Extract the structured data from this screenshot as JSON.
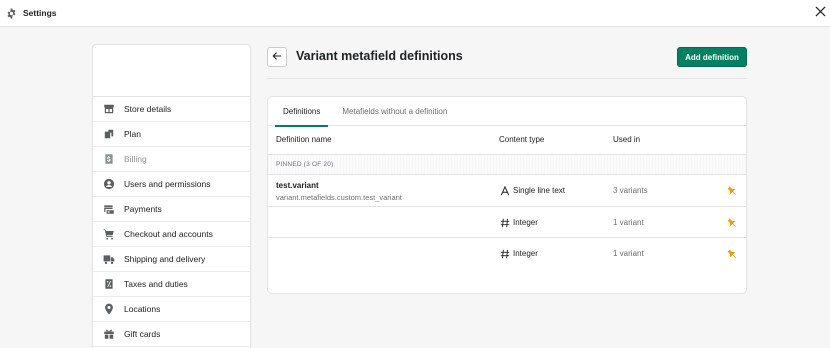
{
  "window": {
    "title": "Settings"
  },
  "sidebar": {
    "items": [
      {
        "label": "Store details",
        "icon": "store-icon",
        "disabled": false
      },
      {
        "label": "Plan",
        "icon": "plan-icon",
        "disabled": false
      },
      {
        "label": "Billing",
        "icon": "billing-icon",
        "disabled": true
      },
      {
        "label": "Users and permissions",
        "icon": "user-icon",
        "disabled": false
      },
      {
        "label": "Payments",
        "icon": "payments-icon",
        "disabled": false
      },
      {
        "label": "Checkout and accounts",
        "icon": "cart-icon",
        "disabled": false
      },
      {
        "label": "Shipping and delivery",
        "icon": "truck-icon",
        "disabled": false
      },
      {
        "label": "Taxes and duties",
        "icon": "tax-icon",
        "disabled": false
      },
      {
        "label": "Locations",
        "icon": "location-pin-icon",
        "disabled": false
      },
      {
        "label": "Gift cards",
        "icon": "gift-icon",
        "disabled": false
      }
    ]
  },
  "header": {
    "title": "Variant metafield definitions",
    "add_label": "Add definition"
  },
  "tabs": [
    {
      "label": "Definitions",
      "active": true
    },
    {
      "label": "Metafields without a definition",
      "active": false
    }
  ],
  "table": {
    "columns": {
      "name": "Definition name",
      "type": "Content type",
      "used": "Used in"
    },
    "section_label": "PINNED (3 OF 20)",
    "rows": [
      {
        "name": "test.variant",
        "key": "variant.metafields.custom.test_variant",
        "type": "Single line text",
        "type_icon": "text-icon",
        "used": "3 variants"
      },
      {
        "name": "",
        "key": "",
        "type": "Integer",
        "type_icon": "hash-icon",
        "used": "1 variant"
      },
      {
        "name": "",
        "key": "",
        "type": "Integer",
        "type_icon": "hash-icon",
        "used": "1 variant"
      }
    ]
  },
  "colors": {
    "primary": "#008060",
    "pin": "#e5a00d",
    "icon": "#5c5f62"
  }
}
